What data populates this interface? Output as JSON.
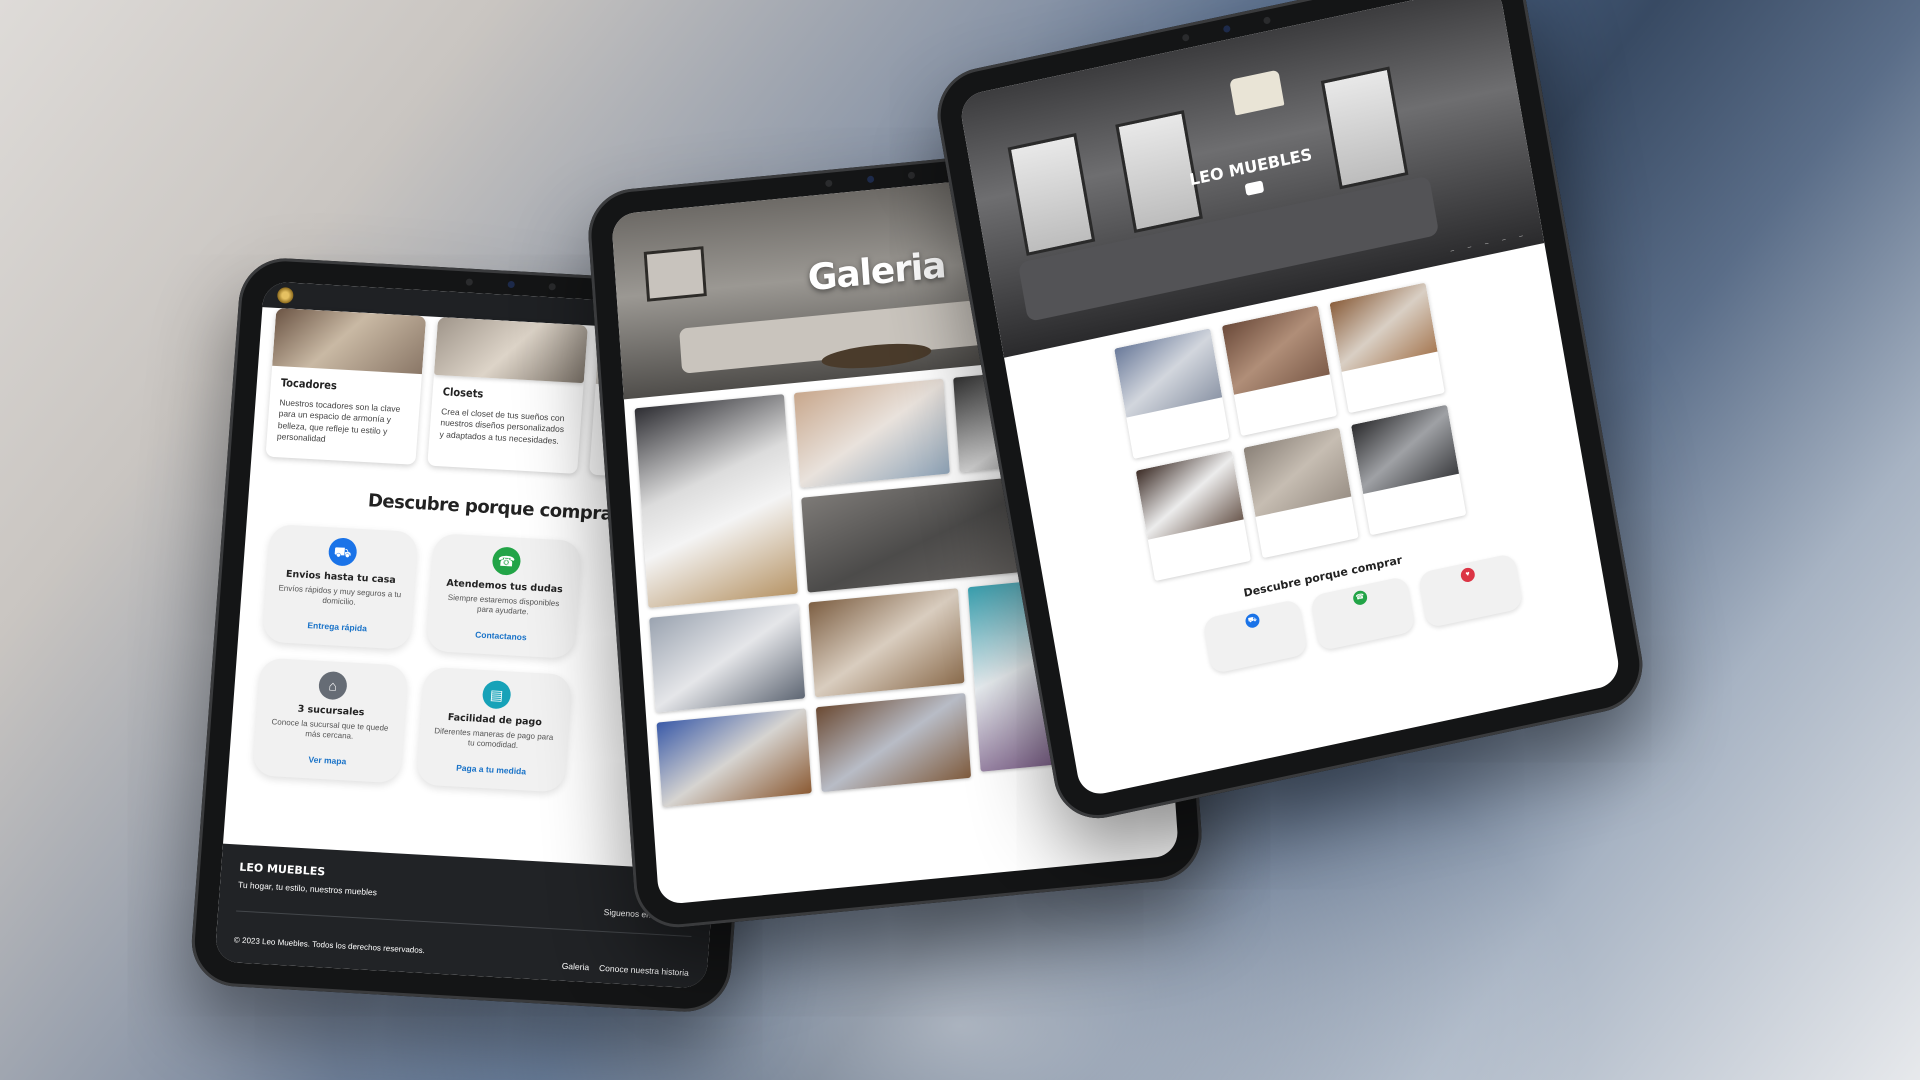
{
  "left_screen": {
    "products": [
      {
        "title": "Tocadores",
        "text": "Nuestros tocadores son la clave para un espacio de armonía y belleza, que refleje tu estilo y personalidad"
      },
      {
        "title": "Closets",
        "text": "Crea el closet de tus sueños con nuestros diseños personalizados y adaptados a tus necesidades."
      }
    ],
    "section_title": "Descubre porque comprar",
    "features": [
      {
        "icon": "truck-icon",
        "color": "#1a73e8",
        "title": "Envios hasta tu casa",
        "text": "Envíos rápidos y muy seguros a tu domicilio.",
        "link": "Entrega rápida"
      },
      {
        "icon": "headset-icon",
        "color": "#22a447",
        "title": "Atendemos tus dudas",
        "text": "Siempre estaremos disponibles para ayudarte.",
        "link": "Contactanos"
      },
      {
        "icon": "store-icon",
        "color": "#666c75",
        "title": "3 sucursales",
        "text": "Conoce la sucursal que te quede más cercana.",
        "link": "Ver mapa"
      },
      {
        "icon": "credit-card-icon",
        "color": "#17a2b8",
        "title": "Facilidad de pago",
        "text": "Diferentes maneras de pago para tu comodidad.",
        "link": "Paga a tu medida"
      }
    ],
    "footer": {
      "brand": "LEO MUEBLES",
      "tagline": "Tu hogar, tu estilo, nuestros muebles",
      "follow": "Siguenos en",
      "copyright": "© 2023 Leo Muebles. Todos los derechos reservados.",
      "links": [
        "Galeria",
        "Conoce nuestra historia"
      ]
    }
  },
  "middle_screen": {
    "hero_title": "Galeria"
  },
  "right_screen": {
    "brand": "LEO MUEBLES",
    "section_title": "Descubre porque comprar"
  },
  "colors": {
    "footer_bg": "#212326",
    "link": "#1a73c8"
  }
}
